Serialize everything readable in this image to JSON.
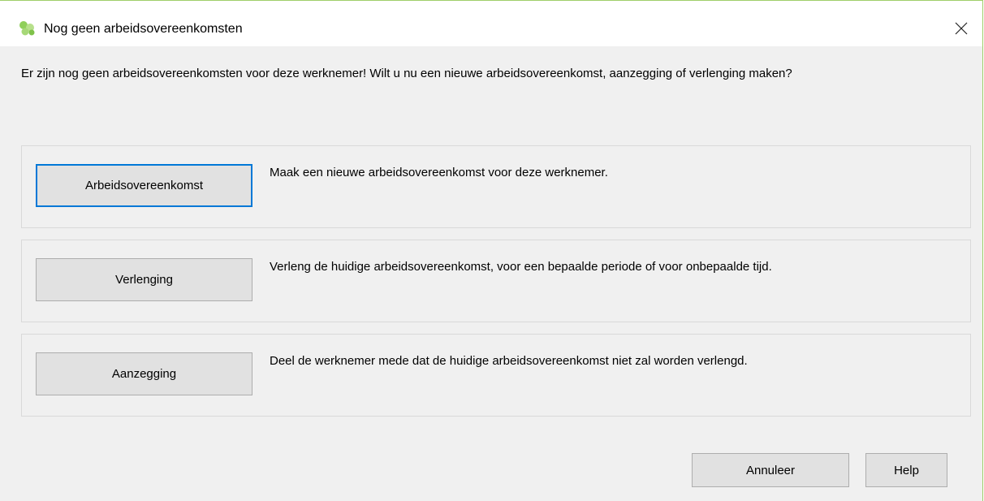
{
  "window": {
    "title": "Nog geen arbeidsovereenkomsten",
    "icon": "app-logo-icon",
    "close_icon": "close-icon",
    "accent_color": "#0078d7",
    "frame_color": "#9fcf6a"
  },
  "message": "Er zijn nog geen arbeidsovereenkomsten voor deze werknemer! Wilt u nu een nieuwe arbeidsovereenkomst, aanzegging of verlenging maken?",
  "options": [
    {
      "button_label": "Arbeidsovereenkomst",
      "description": "Maak een nieuwe arbeidsovereenkomst voor deze werknemer.",
      "focused": true
    },
    {
      "button_label": "Verlenging",
      "description": "Verleng de huidige arbeidsovereenkomst, voor een bepaalde periode of voor onbepaalde tijd.",
      "focused": false
    },
    {
      "button_label": "Aanzegging",
      "description": "Deel de werknemer mede dat de huidige arbeidsovereenkomst niet zal worden verlengd.",
      "focused": false
    }
  ],
  "footer": {
    "cancel_label": "Annuleer",
    "help_label": "Help"
  }
}
